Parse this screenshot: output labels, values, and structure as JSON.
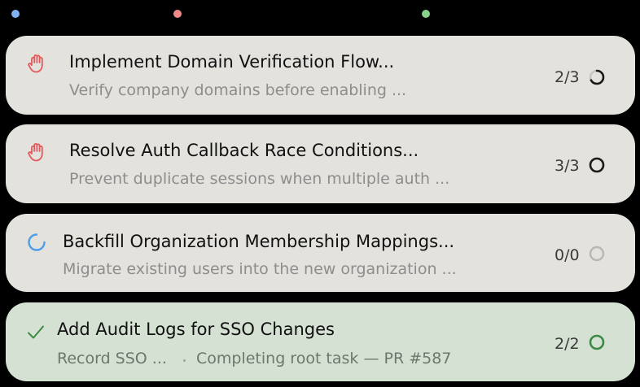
{
  "colors": {
    "background": "#000000",
    "card_default": "#e4e2dd",
    "card_done": "#d5e2d3",
    "dot_blue": "#7fb0f0",
    "dot_red": "#f08a8a",
    "dot_green": "#86d08a",
    "blocked_red": "#e2595c",
    "running_blue": "#4e9de8",
    "done_green": "#3c8a45",
    "progress_dark": "#1b1b1b",
    "progress_muted": "#b7b7b7"
  },
  "tasks": [
    {
      "status_icon": "raised-hand-icon",
      "title": "Implement Domain Verification Flow...",
      "subtitle": "Verify company domains before enabling ...",
      "count": "2/3",
      "progress": 0.67
    },
    {
      "status_icon": "raised-hand-icon",
      "title": "Resolve Auth Callback Race Conditions...",
      "subtitle": "Prevent duplicate sessions when multiple auth ...",
      "count": "3/3",
      "progress": 1.0
    },
    {
      "status_icon": "spinner-icon",
      "title": "Backfill Organization Membership Mappings...",
      "subtitle": "Migrate existing users into the new organization ...",
      "count": "0/0",
      "progress": 0
    },
    {
      "status_icon": "checkmark-icon",
      "title": "Add Audit Logs for SSO Changes",
      "subtitle": "Record SSO ...",
      "subtitle_extra": "Completing root task — PR #587",
      "count": "2/2",
      "progress": 1.0
    }
  ]
}
